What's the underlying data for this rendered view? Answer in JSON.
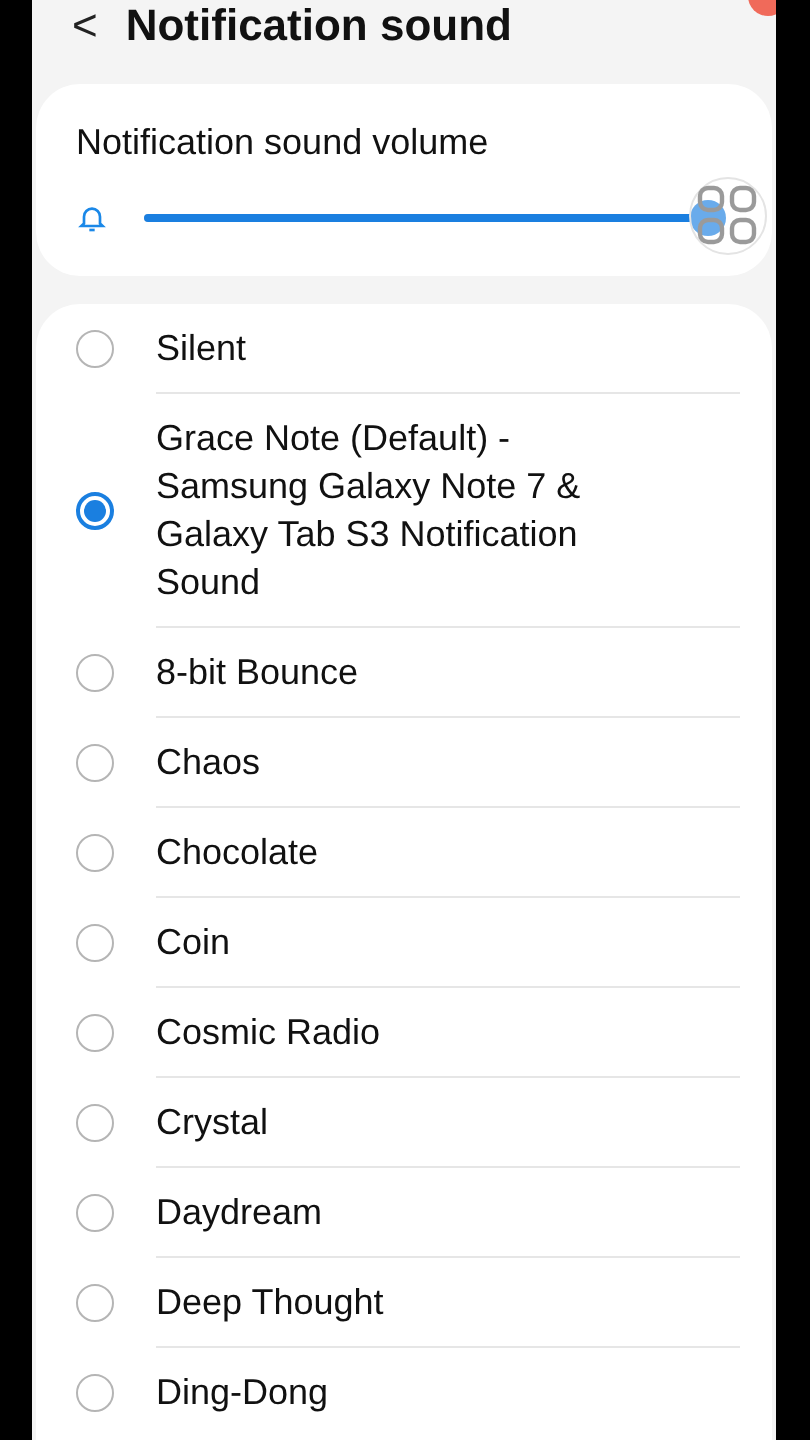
{
  "header": {
    "back": "<",
    "title": "Notification sound"
  },
  "volume": {
    "label": "Notification sound volume",
    "level": 0.98
  },
  "sounds": [
    {
      "label": "Silent",
      "selected": false
    },
    {
      "label": "Grace Note (Default) - Samsung Galaxy Note 7 & Galaxy Tab S3 Notification Sound",
      "selected": true
    },
    {
      "label": "8-bit Bounce",
      "selected": false
    },
    {
      "label": "Chaos",
      "selected": false
    },
    {
      "label": "Chocolate",
      "selected": false
    },
    {
      "label": "Coin",
      "selected": false
    },
    {
      "label": "Cosmic Radio",
      "selected": false
    },
    {
      "label": "Crystal",
      "selected": false
    },
    {
      "label": "Daydream",
      "selected": false
    },
    {
      "label": "Deep Thought",
      "selected": false
    },
    {
      "label": "Ding-Dong",
      "selected": false
    }
  ]
}
